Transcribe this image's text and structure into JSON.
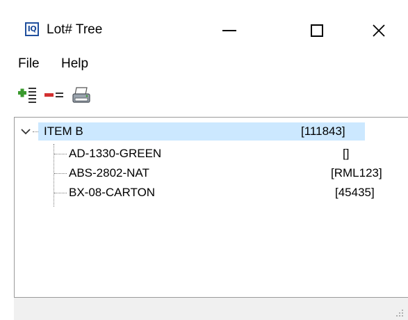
{
  "window": {
    "title": "Lot# Tree",
    "app_icon_text": "IQ",
    "icons": {
      "minimize": "minimize-icon",
      "maximize": "maximize-icon",
      "close": "close-icon"
    }
  },
  "menu": [
    {
      "label": "File"
    },
    {
      "label": "Help"
    }
  ],
  "toolbar": {
    "buttons": [
      {
        "icon": "add-lot-icon"
      },
      {
        "icon": "remove-lot-icon"
      },
      {
        "icon": "printer-icon"
      }
    ]
  },
  "tree": {
    "root": {
      "label": "ITEM B",
      "value": "[111843]",
      "expanded": true,
      "selected": true,
      "children": [
        {
          "label": "AD-1330-GREEN",
          "value": "[]"
        },
        {
          "label": "ABS-2802-NAT",
          "value": "[RML123]"
        },
        {
          "label": "BX-08-CARTON",
          "value": "[45435]"
        }
      ]
    }
  },
  "colors": {
    "selection": "#cce8ff",
    "icon_border": "#1f4e9c",
    "status_bar": "#f0f0f0"
  }
}
